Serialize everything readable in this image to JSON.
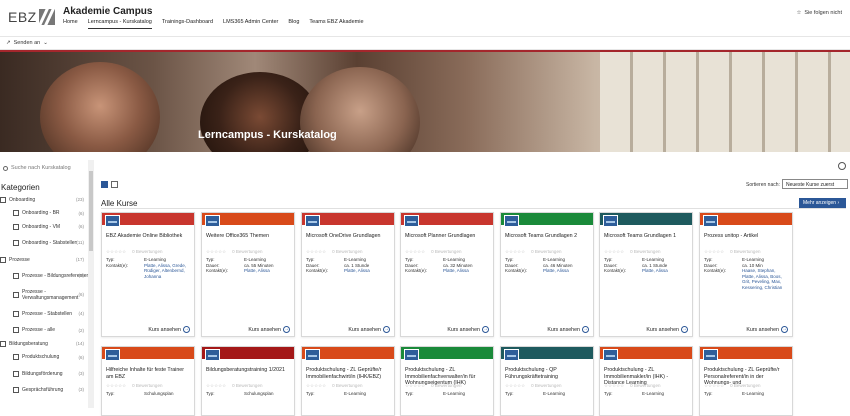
{
  "logo": {
    "text": "EBZ"
  },
  "site": {
    "title": "Akademie Campus",
    "nav": [
      "Home",
      "Lerncampus - Kurskatalog",
      "Trainings-Dashboard",
      "LMS365 Admin Center",
      "Blog",
      "Teams EBZ Akademie"
    ],
    "follow": "Sie folgen nicht",
    "follow_icon": "star-icon"
  },
  "toolbar": {
    "send_label": "Senden an",
    "send_icon": "share-icon"
  },
  "hero": {
    "title": "Lerncampus - Kurskatalog"
  },
  "sidebar": {
    "search_placeholder": "Suche nach Kurskatalog",
    "heading": "Kategorien",
    "items": [
      {
        "label": "Onboarding",
        "count": "(23)",
        "level": 0
      },
      {
        "label": "Onboarding - BR",
        "count": "(6)",
        "level": 1
      },
      {
        "label": "Onboarding - VM",
        "count": "(6)",
        "level": 1
      },
      {
        "label": "Onboarding - Stabstellen",
        "count": "(11)",
        "level": 1
      },
      {
        "label": "Prozesse",
        "count": "(17)",
        "level": 0
      },
      {
        "label": "Prozesse - Bildungsreferenten",
        "count": "(5)",
        "level": 1
      },
      {
        "label": "Prozesse - Verwaltungsmanagement",
        "count": "(6)",
        "level": 1
      },
      {
        "label": "Prozesse - Stabstellen",
        "count": "(4)",
        "level": 1
      },
      {
        "label": "Prozesse - alle",
        "count": "(2)",
        "level": 1
      },
      {
        "label": "Bildungsberatung",
        "count": "(14)",
        "level": 0
      },
      {
        "label": "Produktschulung",
        "count": "(6)",
        "level": 1
      },
      {
        "label": "Bildungsförderung",
        "count": "(3)",
        "level": 1
      },
      {
        "label": "Gesprächsführung",
        "count": "(3)",
        "level": 1
      }
    ]
  },
  "catalog": {
    "sort_label": "Sortieren nach:",
    "sort_value": "Neueste Kurse zuerst",
    "section_title": "Alle Kurse",
    "more_button": "Mehr anzeigen",
    "ratings": "0 Bewertungen",
    "type_label": "Typ:",
    "duration_label": "Dauer:",
    "contact_label": "Kontakt(e):",
    "link_label": "Kurs ansehen",
    "row1": [
      {
        "title": "EBZ Akademie Online Bibliothek",
        "color": "#c8362e",
        "type": "E-Learning",
        "contacts": "Platte, Alissa, Grede, Rüdiger, Altenbernd, Johanna",
        "duration": ""
      },
      {
        "title": "Weitere Office365 Themen",
        "color": "#d84a1a",
        "type": "E-Learning",
        "duration": "ca. 55 Minuten",
        "contacts": "Platte, Alissa"
      },
      {
        "title": "Microsoft OneDrive Grundlagen",
        "color": "#c8362e",
        "type": "E-Learning",
        "duration": "ca. 1 Stunde",
        "contacts": "Platte, Alissa"
      },
      {
        "title": "Microsoft Planner Grundlagen",
        "color": "#c8362e",
        "type": "E-Learning",
        "duration": "ca. 32 Minuten",
        "contacts": "Platte, Alissa"
      },
      {
        "title": "Microsoft Teams Grundlagen 2",
        "color": "#1a8a3a",
        "type": "E-Learning",
        "duration": "ca. 46 Minuten",
        "contacts": "Platte, Alissa"
      },
      {
        "title": "Microsoft Teams Grundlagen 1",
        "color": "#1e5a5e",
        "type": "E-Learning",
        "duration": "ca. 1 Stunde",
        "contacts": "Platte, Alissa"
      },
      {
        "title": "Prozess unitop - Artikel",
        "color": "#d84a1a",
        "type": "E-Learning",
        "duration": "ca. 10 Min",
        "contacts": "Haase, Stephan, Platte, Alissa, Boos, Grit, Peveling, Max, Kessering, Christian"
      }
    ],
    "row2": [
      {
        "title": "Hilfreiche Inhalte für feste Trainer am EBZ",
        "color": "#d84a1a",
        "type": "Schulungsplan"
      },
      {
        "title": "Bildungsberatungstraining 1/2021",
        "color": "#a41818",
        "type": "Schulungsplan"
      },
      {
        "title": "Produktschulung - ZL Geprüfte/r Immobilienfachwirt/in (IHK/EBZ)",
        "color": "#d84a1a",
        "type": "E-Learning"
      },
      {
        "title": "Produktschulung - ZL Immobilienfachverwalter/in für Wohnungseigentum (IHK)",
        "color": "#1a8a3a",
        "type": "E-Learning"
      },
      {
        "title": "Produktschulung - QP Führungskräftetraining",
        "color": "#1e5a5e",
        "type": "E-Learning"
      },
      {
        "title": "Produktschulung - ZL Immobilienmakler/in (IHK) - Distance Learning",
        "color": "#d84a1a",
        "type": "E-Learning"
      },
      {
        "title": "Produktschulung - ZL Geprüfte/r Personalreferent/in in der Wohnungs- und",
        "color": "#d84a1a",
        "type": "E-Learning"
      }
    ]
  }
}
